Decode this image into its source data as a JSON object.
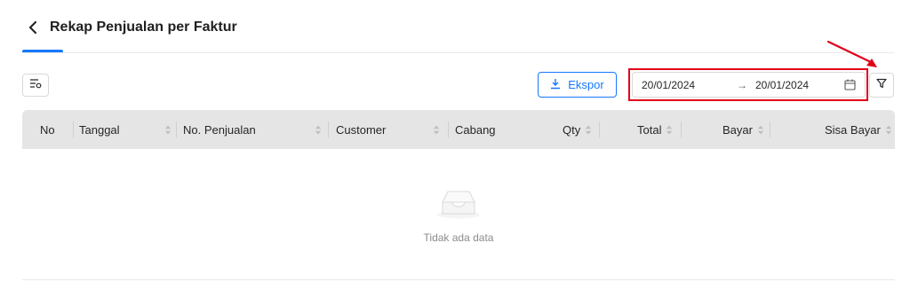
{
  "page": {
    "title": "Rekap Penjualan per Faktur"
  },
  "toolbar": {
    "export_label": "Ekspor",
    "date_range": {
      "start": "20/01/2024",
      "separator": "→",
      "end": "20/01/2024"
    }
  },
  "table": {
    "columns": [
      "No",
      "Tanggal",
      "No. Penjualan",
      "Customer",
      "Cabang",
      "Qty",
      "Total",
      "Bayar",
      "Sisa Bayar"
    ],
    "rows": [],
    "empty_text": "Tidak ada data"
  },
  "colors": {
    "primary": "#1677ff",
    "annotation": "#e1001a",
    "header_bg": "#e5e5e5"
  },
  "icons": {
    "back": "chevron-left-icon",
    "columns": "column-settings-icon",
    "export": "download-icon",
    "calendar": "calendar-icon",
    "filter": "filter-icon",
    "empty": "empty-inbox-icon"
  }
}
